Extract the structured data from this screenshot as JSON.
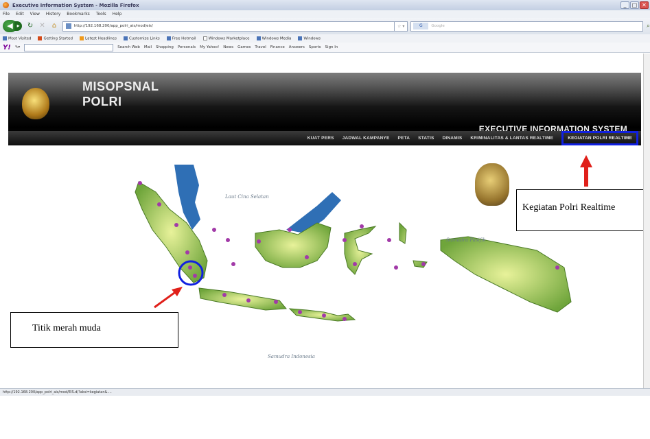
{
  "window": {
    "title": "Executive Information System - Mozilla Firefox",
    "buttons": [
      "_",
      "□",
      "✕"
    ]
  },
  "menubar": [
    "File",
    "Edit",
    "View",
    "History",
    "Bookmarks",
    "Tools",
    "Help"
  ],
  "navbar": {
    "back_icon": "back-arrow",
    "url": "http://192.168.200/app_polri_ais/mod/eis/",
    "search_engine": "G",
    "search_placeholder": "Google"
  },
  "bookmarks": [
    "Most Visited",
    "Getting Started",
    "Latest Headlines",
    "Customize Links",
    "Free Hotmail",
    "Windows Marketplace",
    "Windows Media",
    "Windows"
  ],
  "yahoo": {
    "logo": "Y!",
    "items": [
      "Search Web",
      "Mail",
      "Shopping",
      "Personals",
      "My Yahoo!",
      "News",
      "Games",
      "Travel",
      "Finance",
      "Answers",
      "Sports",
      "Sign In"
    ]
  },
  "banner": {
    "title_line1": "MISOPSNAL",
    "title_line2": "POLRI",
    "subtitle": "EXECUTIVE INFORMATION SYSTEM"
  },
  "menu": [
    "KUAT PERS",
    "JADWAL KAMPANYE",
    "PETA",
    "STATIS",
    "DINAMIS",
    "KRIMINALITAS & LANTAS REALTIME",
    "KEGIATAN POLRI REALTIME"
  ],
  "map": {
    "sea_north": "Laut Cina Selatan",
    "sea_east": "Samudra Pasifik",
    "sea_south": "Samudra Indonesia",
    "colors": {
      "land_light": "#d6e98a",
      "land_dark": "#6fa53b",
      "water": "#2f6fb5",
      "marker": "#a23aa8"
    }
  },
  "annotations": {
    "kegiatan": "Kegiatan Polri Realtime",
    "titik": "Titik merah muda",
    "highlight_color": "#1020e0",
    "arrow_color": "#e0201a"
  },
  "status": "http://192.168.200/app_polri_ais/mod/EIS.d/?aksi=kegiatan&...."
}
